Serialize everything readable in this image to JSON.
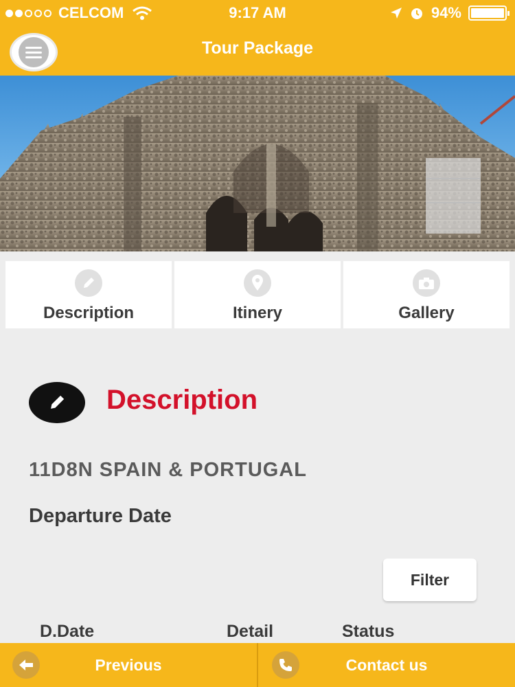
{
  "status_bar": {
    "carrier": "CELCOM",
    "time": "9:17 AM",
    "battery": "94%"
  },
  "nav": {
    "title": "Tour Package",
    "menu_icon": "hamburger-menu-icon"
  },
  "tabs": [
    {
      "label": "Description",
      "icon": "pencil-icon"
    },
    {
      "label": "Itinery",
      "icon": "map-pin-icon"
    },
    {
      "label": "Gallery",
      "icon": "camera-icon"
    }
  ],
  "section": {
    "title": "Description",
    "icon": "pencil-icon"
  },
  "package": {
    "name": "11D8N SPAIN & PORTUGAL",
    "departure_label": "Departure Date"
  },
  "filter": {
    "label": "Filter"
  },
  "table": {
    "columns": [
      "D.Date",
      "Detail",
      "Status"
    ]
  },
  "bottom": {
    "previous_label": "Previous",
    "contact_label": "Contact us"
  },
  "colors": {
    "accent": "#f6b71b",
    "title_red": "#d3112a",
    "background": "#ededed"
  }
}
